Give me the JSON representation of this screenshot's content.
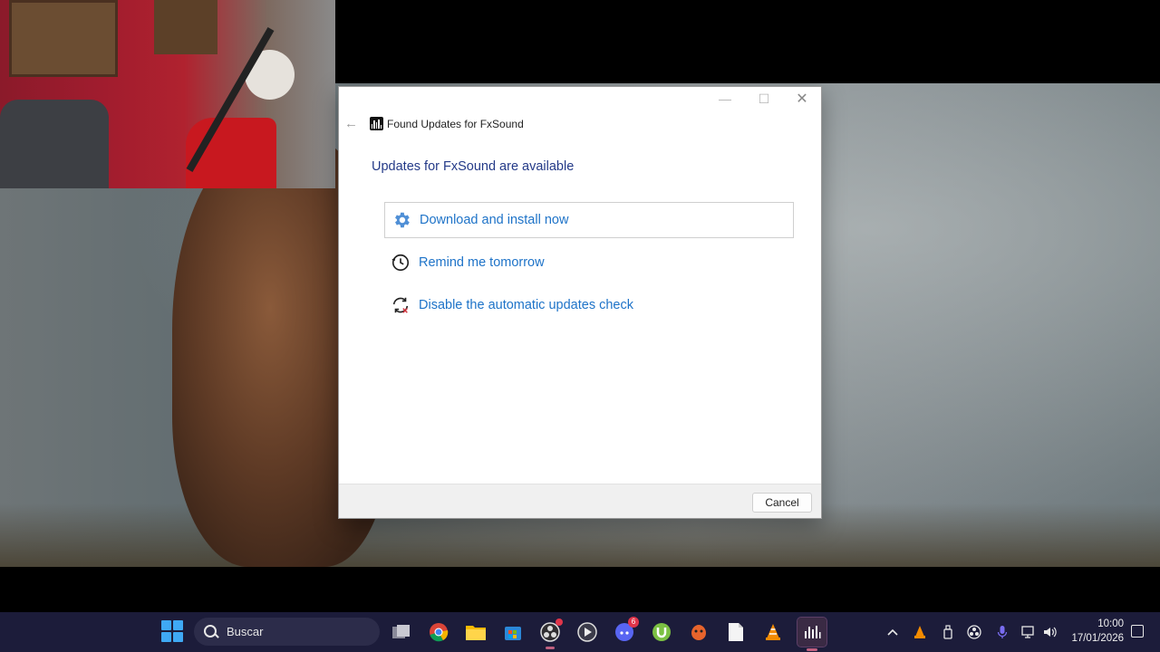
{
  "dialog": {
    "window_title": "Found Updates for FxSound",
    "main_instruction": "Updates for FxSound are available",
    "commands": [
      {
        "label": "Download and install now",
        "icon": "gear-icon"
      },
      {
        "label": "Remind me tomorrow",
        "icon": "history-icon"
      },
      {
        "label": "Disable the automatic updates check",
        "icon": "sync-disabled-icon"
      }
    ],
    "cancel_label": "Cancel",
    "accent_color": "#1e73c8",
    "instruction_color": "#243a88"
  },
  "taskbar": {
    "search_placeholder": "Buscar",
    "pinned": [
      {
        "name": "file-explorer-multitask-icon"
      },
      {
        "name": "chrome-icon"
      },
      {
        "name": "file-explorer-icon"
      },
      {
        "name": "microsoft-store-icon"
      },
      {
        "name": "obs-icon"
      },
      {
        "name": "media-player-icon"
      },
      {
        "name": "discord-icon",
        "badge": "6"
      },
      {
        "name": "utorrent-icon"
      },
      {
        "name": "scratch-icon"
      },
      {
        "name": "notepad-icon"
      },
      {
        "name": "vlc-icon"
      },
      {
        "name": "fxsound-icon"
      }
    ],
    "clock_time": "10:00",
    "clock_date": "17/01/2026",
    "background": "#1c1c3a"
  }
}
